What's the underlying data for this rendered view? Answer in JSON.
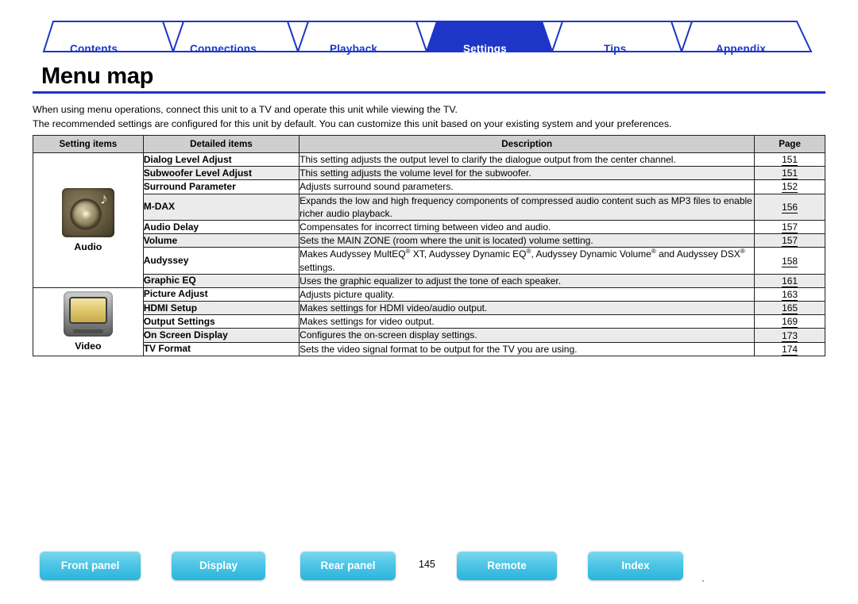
{
  "tabs": [
    {
      "label": "Contents",
      "active": false
    },
    {
      "label": "Connections",
      "active": false
    },
    {
      "label": "Playback",
      "active": false
    },
    {
      "label": "Settings",
      "active": true
    },
    {
      "label": "Tips",
      "active": false
    },
    {
      "label": "Appendix",
      "active": false
    }
  ],
  "page_title": "Menu map",
  "intro": {
    "line1": "When using menu operations, connect this unit to a TV and operate this unit while viewing the TV.",
    "line2": "The recommended settings are configured for this unit by default. You can customize this unit based on your existing system and your preferences."
  },
  "table": {
    "headers": [
      "Setting items",
      "Detailed items",
      "Description",
      "Page"
    ],
    "groups": [
      {
        "name": "Audio",
        "icon": "audio-speaker-icon",
        "rows": [
          {
            "detail": "Dialog Level Adjust",
            "description": "This setting adjusts the output level to clarify the dialogue output from the center channel.",
            "page": "151",
            "shaded": false
          },
          {
            "detail": "Subwoofer Level Adjust",
            "description": "This setting adjusts the volume level for the subwoofer.",
            "page": "151",
            "shaded": true
          },
          {
            "detail": "Surround Parameter",
            "description": "Adjusts surround sound parameters.",
            "page": "152",
            "shaded": false
          },
          {
            "detail": "M-DAX",
            "description": "Expands the low and high frequency components of compressed audio content such as MP3 files to enable richer audio playback.",
            "page": "156",
            "shaded": true
          },
          {
            "detail": "Audio Delay",
            "description": "Compensates for incorrect timing between video and audio.",
            "page": "157",
            "shaded": false
          },
          {
            "detail": "Volume",
            "description": "Sets the MAIN ZONE (room where the unit is located) volume setting.",
            "page": "157",
            "shaded": true
          },
          {
            "detail": "Audyssey",
            "description": "Makes Audyssey MultEQ® XT, Audyssey Dynamic EQ®, Audyssey Dynamic Volume® and Audyssey DSX® settings.",
            "page": "158",
            "shaded": false
          },
          {
            "detail": "Graphic EQ",
            "description": "Uses the graphic equalizer to adjust the tone of each speaker.",
            "page": "161",
            "shaded": true
          }
        ]
      },
      {
        "name": "Video",
        "icon": "video-tv-icon",
        "rows": [
          {
            "detail": "Picture Adjust",
            "description": "Adjusts picture quality.",
            "page": "163",
            "shaded": false
          },
          {
            "detail": "HDMI Setup",
            "description": "Makes settings for HDMI video/audio output.",
            "page": "165",
            "shaded": true
          },
          {
            "detail": "Output Settings",
            "description": "Makes settings for video output.",
            "page": "169",
            "shaded": false
          },
          {
            "detail": "On Screen Display",
            "description": "Configures the on-screen display settings.",
            "page": "173",
            "shaded": true
          },
          {
            "detail": "TV Format",
            "description": "Sets the video signal format to be output for the TV you are using.",
            "page": "174",
            "shaded": false
          }
        ]
      }
    ]
  },
  "bottom_bar": {
    "buttons": [
      {
        "label": "Front panel"
      },
      {
        "label": "Display"
      },
      {
        "label": "Rear panel"
      },
      {
        "label": "Remote"
      },
      {
        "label": "Index"
      }
    ],
    "page_number": "145"
  },
  "colors": {
    "accent": "#1d36c8",
    "tab_active_bg": "#1d36c8",
    "bottom_button": "#4fc6e6",
    "header_row": "#cfcfcf",
    "shaded_row": "#ebebeb"
  }
}
